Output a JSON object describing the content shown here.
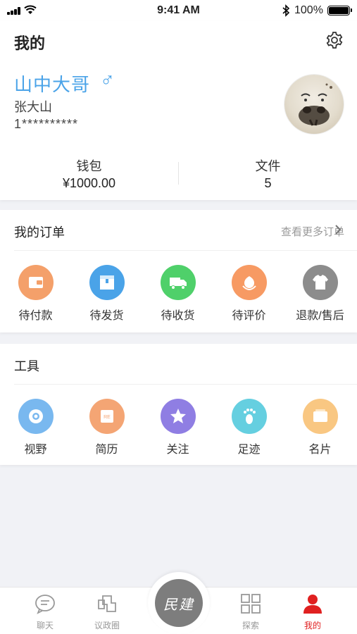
{
  "status_bar": {
    "time": "9:41 AM",
    "battery": "100%"
  },
  "header": {
    "title": "我的"
  },
  "profile": {
    "nickname": "山中大哥",
    "gender_symbol": "♂",
    "real_name": "张大山",
    "phone": "1**********"
  },
  "stats": [
    {
      "label": "钱包",
      "value": "¥1000.00"
    },
    {
      "label": "文件",
      "value": "5"
    }
  ],
  "orders": {
    "title": "我的订单",
    "more_label": "查看更多订单",
    "items": [
      {
        "label": "待付款",
        "icon": "wallet-icon",
        "color": "#f4a06a"
      },
      {
        "label": "待发货",
        "icon": "box-icon",
        "color": "#4aa3e8"
      },
      {
        "label": "待收货",
        "icon": "truck-icon",
        "color": "#4fd06a"
      },
      {
        "label": "待评价",
        "icon": "flower-icon",
        "color": "#f79a63"
      },
      {
        "label": "退款/售后",
        "icon": "shirt-icon",
        "color": "#8c8c8c"
      }
    ]
  },
  "tools": {
    "title": "工具",
    "items": [
      {
        "label": "视野",
        "icon": "eye-icon",
        "color": "#79b8ef"
      },
      {
        "label": "简历",
        "icon": "resume-icon",
        "color": "#f4a574"
      },
      {
        "label": "关注",
        "icon": "star-icon",
        "color": "#8f7ee3"
      },
      {
        "label": "足迹",
        "icon": "footprint-icon",
        "color": "#65cfe0"
      },
      {
        "label": "名片",
        "icon": "card-icon",
        "color": "#f9c782"
      }
    ]
  },
  "tabbar": {
    "items": [
      {
        "label": "聊天",
        "icon": "chat-icon"
      },
      {
        "label": "议政圈",
        "icon": "circle-icon"
      },
      {
        "label": "探索",
        "icon": "grid-icon"
      },
      {
        "label": "我的",
        "icon": "person-icon",
        "active": true
      }
    ],
    "center_label": "民建"
  },
  "colors": {
    "accent": "#4aa3e8",
    "active_tab": "#e02020"
  }
}
